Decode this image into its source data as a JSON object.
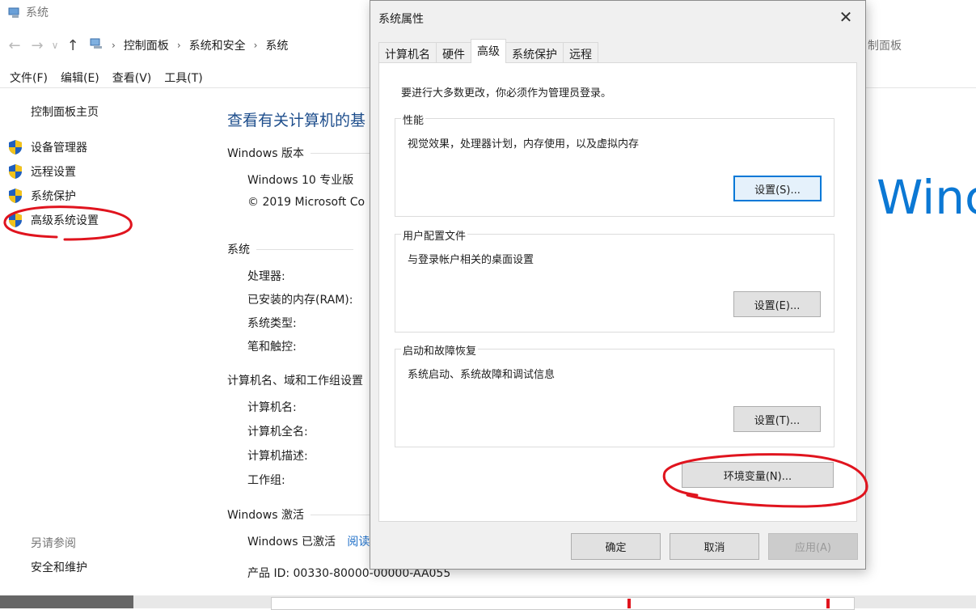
{
  "background": {
    "window_title": "系统",
    "breadcrumb": [
      "控制面板",
      "系统和安全",
      "系统"
    ],
    "right_address": "制面板",
    "menu": [
      "文件(F)",
      "编辑(E)",
      "查看(V)",
      "工具(T)"
    ],
    "sidebar": {
      "home": "控制面板主页",
      "items": [
        "设备管理器",
        "远程设置",
        "系统保护",
        "高级系统设置"
      ],
      "see_also_title": "另请参阅",
      "see_also": [
        "安全和维护"
      ]
    },
    "heading": "查看有关计算机的基",
    "sections": {
      "edition": {
        "title": "Windows 版本",
        "name": "Windows 10 专业版",
        "copyright": "© 2019 Microsoft Co"
      },
      "system": {
        "title": "系统",
        "labels": [
          "处理器:",
          "已安装的内存(RAM):",
          "系统类型:",
          "笔和触控:"
        ]
      },
      "computer": {
        "title": "计算机名、域和工作组设置",
        "labels": [
          "计算机名:",
          "计算机全名:",
          "计算机描述:",
          "工作组:"
        ]
      },
      "activation": {
        "title": "Windows 激活",
        "status": "Windows 已激活",
        "link": "阅读",
        "product_id": "产品 ID: 00330-80000-00000-AA055"
      }
    },
    "logo_text": "Winc"
  },
  "dialog": {
    "title": "系统属性",
    "tabs": [
      "计算机名",
      "硬件",
      "高级",
      "系统保护",
      "远程"
    ],
    "active_tab": "高级",
    "notice": "要进行大多数更改，你必须作为管理员登录。",
    "groups": [
      {
        "title": "性能",
        "desc": "视觉效果，处理器计划，内存使用，以及虚拟内存",
        "button": "设置(S)..."
      },
      {
        "title": "用户配置文件",
        "desc": "与登录帐户相关的桌面设置",
        "button": "设置(E)..."
      },
      {
        "title": "启动和故障恢复",
        "desc": "系统启动、系统故障和调试信息",
        "button": "设置(T)..."
      }
    ],
    "env_button": "环境变量(N)...",
    "ok": "确定",
    "cancel": "取消",
    "apply": "应用(A)"
  },
  "colors": {
    "link_blue": "#1e4e8c",
    "accent": "#0078d7",
    "annotation_red": "#e0141e"
  }
}
